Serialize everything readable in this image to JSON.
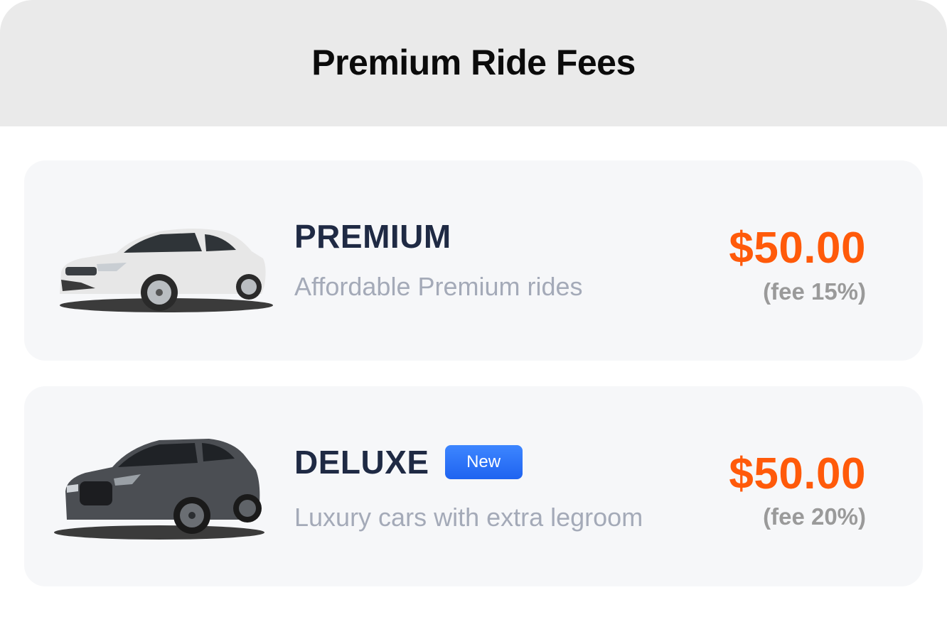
{
  "header": {
    "title": "Premium Ride Fees"
  },
  "rides": [
    {
      "name": "PREMIUM",
      "badge": "",
      "description": "Affordable Premium rides",
      "price": "$50.00",
      "fee": "(fee 15%)",
      "image": "white-sedan-car-icon"
    },
    {
      "name": "DELUXE",
      "badge": "New",
      "description": "Luxury cars with extra legroom",
      "price": "$50.00",
      "fee": "(fee 20%)",
      "image": "dark-gray-suv-car-icon"
    }
  ],
  "colors": {
    "accent_price": "#ff5a0a",
    "badge_blue": "#2f72f8",
    "title_navy": "#1f2a44",
    "header_bg": "#eaeaea",
    "card_bg": "#f6f7f9"
  }
}
